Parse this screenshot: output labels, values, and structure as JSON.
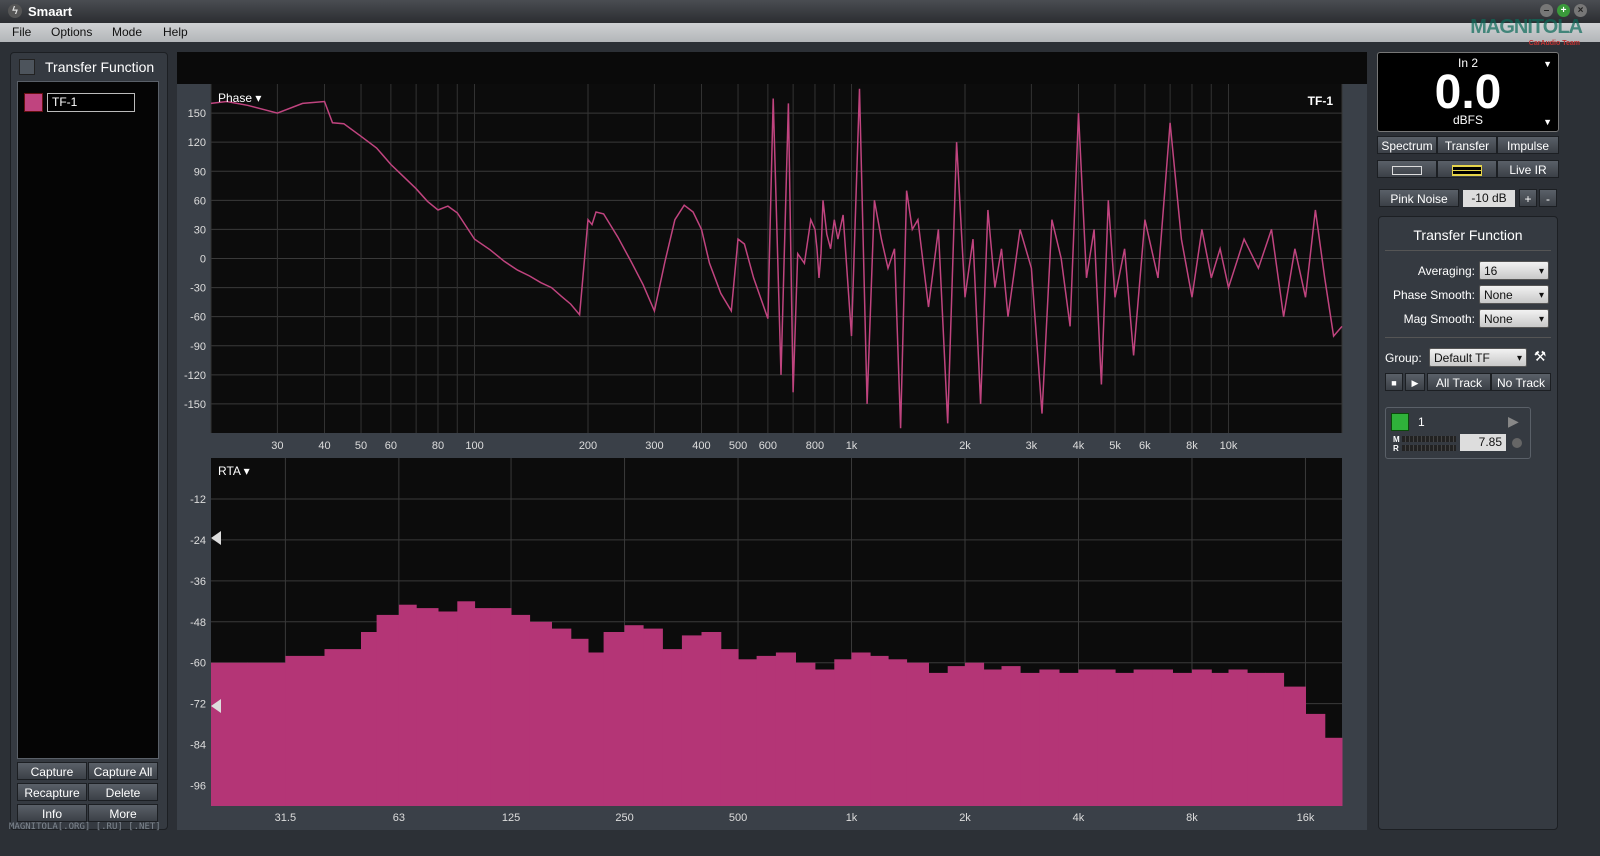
{
  "window": {
    "title": "Smaart"
  },
  "menu": [
    "File",
    "Options",
    "Mode",
    "Help"
  ],
  "logo": {
    "text": "MAGNITOLA",
    "sub": "CarAudio Team"
  },
  "left_panel": {
    "title": "Transfer Function",
    "measurement_name": "TF-1",
    "measurement_color": "#c0447f",
    "buttons": {
      "capture": "Capture",
      "capture_all": "Capture All",
      "recapture": "Recapture",
      "delete": "Delete",
      "info": "Info",
      "more": "More"
    }
  },
  "phase_plot": {
    "selector_label": "Phase ▾",
    "trace_label": "TF-1",
    "y_ticks": [
      "150",
      "120",
      "90",
      "60",
      "30",
      "0",
      "-30",
      "-60",
      "-90",
      "-120",
      "-150"
    ],
    "x_ticks": [
      "30",
      "40",
      "50",
      "60",
      "80",
      "100",
      "200",
      "300",
      "400",
      "500",
      "600",
      "800",
      "1k",
      "2k",
      "3k",
      "4k",
      "5k",
      "6k",
      "8k",
      "10k"
    ]
  },
  "rta_plot": {
    "selector_label": "RTA ▾",
    "y_ticks": [
      "-12",
      "-24",
      "-36",
      "-48",
      "-60",
      "-72",
      "-84",
      "-96"
    ],
    "x_ticks": [
      "31.5",
      "63",
      "125",
      "250",
      "500",
      "1k",
      "2k",
      "4k",
      "8k",
      "16k"
    ]
  },
  "chart_data": [
    {
      "type": "line",
      "title": "",
      "xlabel": "",
      "ylabel": "",
      "x_scale": "log",
      "xlim": [
        20,
        20000
      ],
      "ylim": [
        -180,
        180
      ],
      "grid": true,
      "series": [
        {
          "name": "TF-1",
          "color": "#c0447f",
          "x": [
            20,
            22,
            25,
            30,
            35,
            40,
            42,
            45,
            50,
            55,
            60,
            65,
            70,
            75,
            80,
            85,
            90,
            100,
            110,
            120,
            130,
            140,
            150,
            160,
            170,
            180,
            190,
            200,
            205,
            210,
            220,
            240,
            260,
            280,
            300,
            320,
            340,
            360,
            380,
            400,
            420,
            450,
            480,
            500,
            520,
            550,
            600,
            620,
            650,
            680,
            700,
            720,
            750,
            780,
            800,
            810,
            820,
            830,
            840,
            860,
            880,
            900,
            920,
            950,
            1000,
            1050,
            1100,
            1150,
            1200,
            1250,
            1300,
            1350,
            1400,
            1450,
            1500,
            1600,
            1700,
            1800,
            1900,
            2000,
            2100,
            2200,
            2300,
            2400,
            2500,
            2600,
            2800,
            3000,
            3200,
            3400,
            3600,
            3800,
            4000,
            4200,
            4400,
            4600,
            4800,
            5000,
            5300,
            5600,
            6000,
            6500,
            7000,
            7500,
            8000,
            8500,
            9000,
            9500,
            10000,
            11000,
            12000,
            13000,
            14000,
            15000,
            16000,
            17000,
            18000,
            19000,
            20000
          ],
          "y": [
            160,
            162,
            158,
            150,
            160,
            162,
            140,
            139,
            126,
            114,
            97,
            84,
            72,
            59,
            50,
            54,
            47,
            20,
            9,
            -3,
            -12,
            -18,
            -25,
            -30,
            -39,
            -47,
            -58,
            40,
            35,
            48,
            46,
            22,
            -3,
            -27,
            -54,
            -3,
            40,
            55,
            48,
            30,
            -5,
            -36,
            -54,
            20,
            15,
            -20,
            -62,
            165,
            -120,
            160,
            -138,
            5,
            -5,
            40,
            30,
            10,
            -20,
            5,
            60,
            25,
            10,
            40,
            20,
            45,
            -80,
            175,
            -150,
            60,
            20,
            -10,
            10,
            -175,
            70,
            30,
            40,
            -50,
            30,
            -170,
            120,
            -40,
            20,
            -150,
            50,
            -30,
            10,
            -60,
            30,
            -10,
            -160,
            40,
            0,
            -70,
            150,
            -20,
            30,
            -130,
            60,
            -40,
            10,
            -100,
            40,
            -20,
            140,
            20,
            -40,
            30,
            -20,
            10,
            -30,
            20,
            -10,
            30,
            -60,
            10,
            -40,
            50,
            -20,
            -80,
            -70
          ]
        }
      ]
    },
    {
      "type": "area",
      "title": "",
      "xlabel": "",
      "ylabel": "",
      "x_scale": "log",
      "xlim": [
        20,
        20000
      ],
      "ylim": [
        -102,
        0
      ],
      "grid": true,
      "series": [
        {
          "name": "",
          "color": "#b43576",
          "x": [
            20,
            25,
            31.5,
            40,
            50,
            55,
            63,
            70,
            80,
            90,
            100,
            110,
            125,
            140,
            160,
            180,
            200,
            220,
            250,
            280,
            315,
            355,
            400,
            450,
            500,
            560,
            630,
            710,
            800,
            900,
            1000,
            1120,
            1250,
            1400,
            1600,
            1800,
            2000,
            2240,
            2500,
            2800,
            3150,
            3550,
            4000,
            4500,
            5000,
            5600,
            6300,
            7100,
            8000,
            9000,
            10000,
            11200,
            12500,
            14000,
            16000,
            18000,
            20000
          ],
          "y": [
            -60,
            -60,
            -58,
            -56,
            -51,
            -46,
            -43,
            -44,
            -45,
            -42,
            -44,
            -44,
            -46,
            -48,
            -50,
            -53,
            -57,
            -51,
            -49,
            -50,
            -56,
            -52,
            -51,
            -56,
            -59,
            -58,
            -57,
            -60,
            -62,
            -59,
            -57,
            -58,
            -59,
            -60,
            -63,
            -61,
            -60,
            -62,
            -61,
            -63,
            -62,
            -63,
            -62,
            -62,
            -63,
            -62,
            -62,
            -63,
            -62,
            -63,
            -62,
            -63,
            -63,
            -67,
            -75,
            -82,
            -90
          ]
        }
      ]
    }
  ],
  "right_panel": {
    "meter": {
      "channel": "In 2",
      "value": "0.0",
      "unit": "dBFS"
    },
    "mode_tabs": [
      "Spectrum",
      "Transfer",
      "Impulse"
    ],
    "live_ir": "Live IR",
    "generator": {
      "label": "Pink Noise",
      "level": "-10 dB",
      "plus": "+",
      "minus": "-"
    },
    "settings": {
      "title": "Transfer Function",
      "averaging_label": "Averaging:",
      "averaging_value": "16",
      "phase_smooth_label": "Phase Smooth:",
      "phase_smooth_value": "None",
      "mag_smooth_label": "Mag Smooth:",
      "mag_smooth_value": "None",
      "group_label": "Group:",
      "group_value": "Default TF",
      "all_track": "All Track",
      "no_track": "No Track",
      "engine_label": "1",
      "engine_value": "7.85",
      "meter_m": "M",
      "meter_r": "R"
    }
  },
  "watermark": "MAGNITOLA[.ORG] [.RU] [.NET]"
}
